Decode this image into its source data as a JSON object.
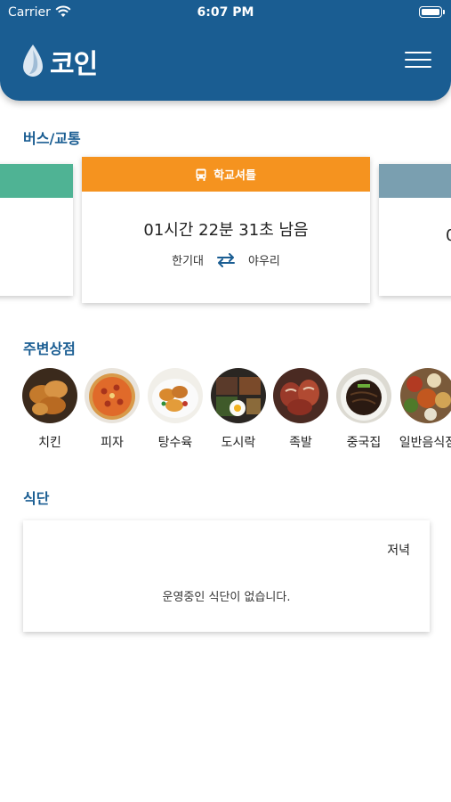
{
  "status_bar": {
    "carrier": "Carrier",
    "time": "6:07 PM"
  },
  "header": {
    "logo_text": "코인"
  },
  "sections": {
    "transport_title": "버스/교통",
    "stores_title": "주변상점",
    "meal_title": "식단"
  },
  "shuttle": {
    "label": "학교셔틀",
    "countdown": "01시간 22분 31초 남음",
    "from": "한기대",
    "to": "야우리",
    "next_card_peek": "0",
    "colors": {
      "shuttle": "#f5931f",
      "prev_card": "#4fb394",
      "next_card": "#7a9fb0"
    }
  },
  "stores": [
    {
      "label": "치킨",
      "icon": "fried-chicken-photo"
    },
    {
      "label": "피자",
      "icon": "pizza-photo"
    },
    {
      "label": "탕수육",
      "icon": "sweet-sour-pork-photo"
    },
    {
      "label": "도시락",
      "icon": "lunchbox-photo"
    },
    {
      "label": "족발",
      "icon": "pork-trotters-photo"
    },
    {
      "label": "중국집",
      "icon": "jajangmyeon-photo"
    },
    {
      "label": "일반음식점",
      "icon": "korean-table-photo"
    }
  ],
  "meal": {
    "time_label": "저녁",
    "empty_message": "운영중인 식단이 없습니다."
  },
  "colors": {
    "brand": "#1a5d92"
  }
}
